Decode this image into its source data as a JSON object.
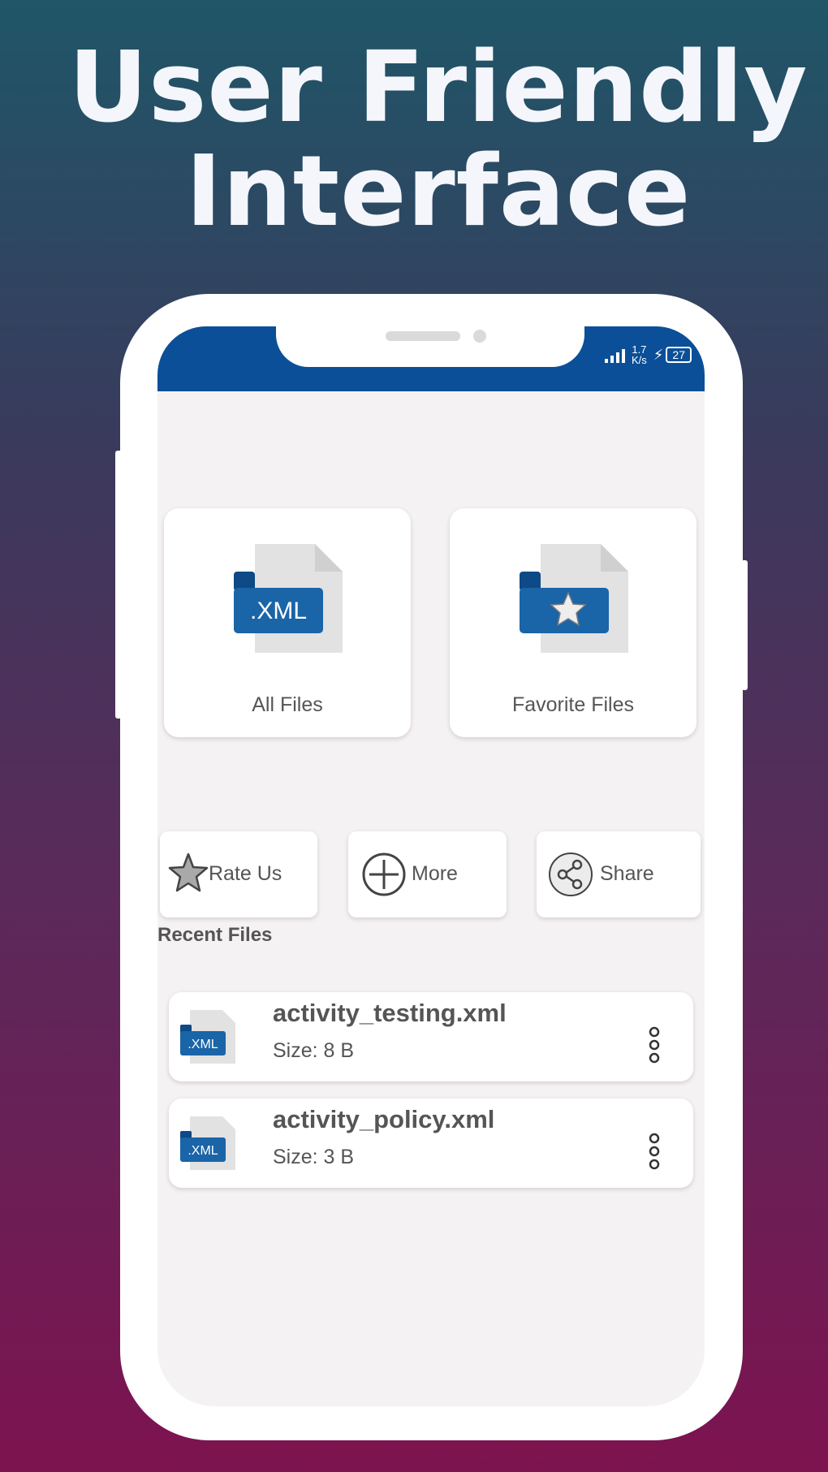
{
  "headline": {
    "line1": "User Friendly",
    "line2": "Interface"
  },
  "status_bar": {
    "speed_value": "1.7",
    "speed_unit": "K/s",
    "battery": "27"
  },
  "tiles": [
    {
      "label": "All Files",
      "icon_text": ".XML",
      "icon": "xml-file-icon"
    },
    {
      "label": "Favorite Files",
      "icon": "favorite-file-icon"
    }
  ],
  "actions": [
    {
      "label": "Rate Us",
      "icon": "star-icon"
    },
    {
      "label": "More",
      "icon": "plus-circle-icon"
    },
    {
      "label": "Share",
      "icon": "share-icon"
    }
  ],
  "recent": {
    "title": "Recent Files",
    "files": [
      {
        "name": "activity_testing.xml",
        "size": "Size: 8 B",
        "icon_text": ".XML"
      },
      {
        "name": "activity_policy.xml",
        "size": "Size: 3 B",
        "icon_text": ".XML"
      }
    ]
  },
  "colors": {
    "brand": "#0b4f98",
    "folder_blue": "#1a64a8",
    "doc_gray": "#e2e2e2"
  }
}
